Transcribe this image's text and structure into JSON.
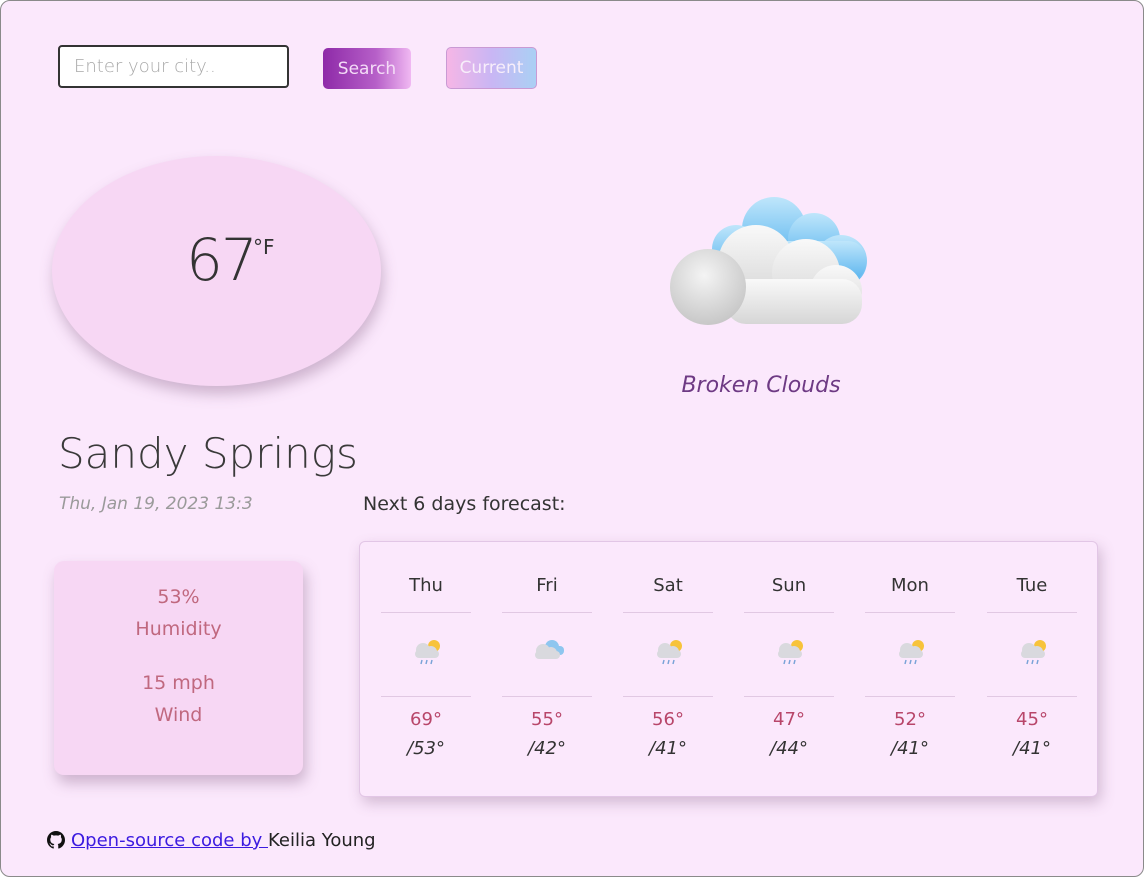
{
  "search": {
    "placeholder": "Enter your city..",
    "search_label": "Search",
    "current_label": "Current"
  },
  "current": {
    "temperature": "67",
    "unit": "°F",
    "icon": "broken-clouds-icon",
    "description": "Broken Clouds",
    "city": "Sandy Springs",
    "datetime": "Thu, Jan 19, 2023 13:3"
  },
  "stats": {
    "humidity_value": "53%",
    "humidity_label": "Humidity",
    "wind_value": "15 mph",
    "wind_label": "Wind"
  },
  "forecast": {
    "title": "Next 6 days forecast:",
    "days": [
      {
        "day": "Thu",
        "icon": "sun-cloud-rain-icon",
        "high": "69°",
        "low": "/53°"
      },
      {
        "day": "Fri",
        "icon": "cloud-icon",
        "high": "55°",
        "low": "/42°"
      },
      {
        "day": "Sat",
        "icon": "sun-cloud-rain-icon",
        "high": "56°",
        "low": "/41°"
      },
      {
        "day": "Sun",
        "icon": "sun-cloud-rain-icon",
        "high": "47°",
        "low": "/44°"
      },
      {
        "day": "Mon",
        "icon": "sun-cloud-rain-icon",
        "high": "52°",
        "low": "/41°"
      },
      {
        "day": "Tue",
        "icon": "sun-cloud-rain-icon",
        "high": "45°",
        "low": "/41°"
      }
    ]
  },
  "footer": {
    "icon": "github-icon",
    "link_text": "Open-source code by ",
    "author": "Keilia Young"
  },
  "colors": {
    "background": "#fbe8fc",
    "card": "#f7d7f4",
    "accent": "#8e2aa8",
    "stat_text": "#c0687f",
    "high_temp": "#b8466a"
  }
}
